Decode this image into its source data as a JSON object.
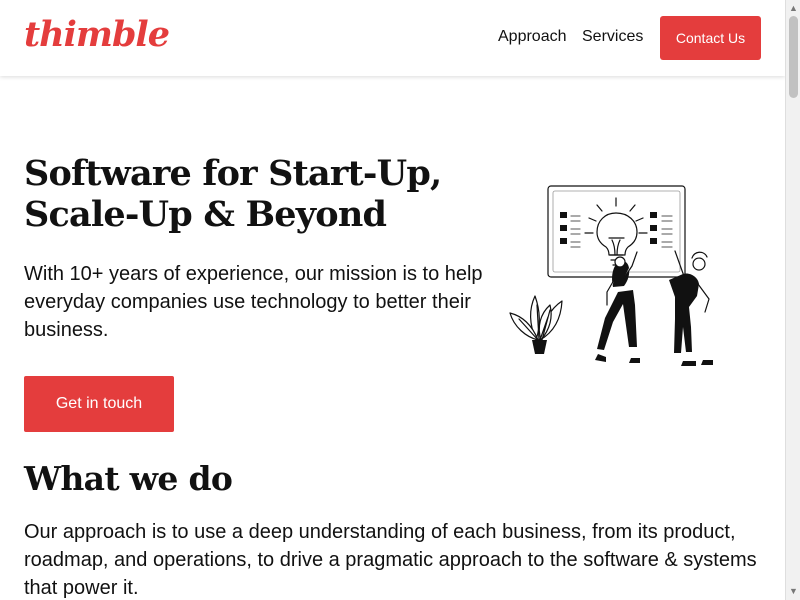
{
  "brand": {
    "name": "thimble",
    "accent_color": "#e43d3d"
  },
  "navigation": {
    "links": [
      {
        "label": "Approach"
      },
      {
        "label": "Services"
      }
    ],
    "contact_button": "Contact Us"
  },
  "hero": {
    "title_lines": [
      "Software for Start-Up,",
      "Scale-Up & Beyond"
    ],
    "description": "With 10+ years of experience, our mission is to help everyday companies use technology to better their business.",
    "button_label": "Get in touch",
    "illustration_icon": "lightbulb-presentation-icon"
  },
  "services": {
    "heading": "What we do",
    "description": "Our approach is to use a deep understanding of each business, from its product, roadmap, and operations, to drive a pragmatic approach to the software & systems that power it."
  },
  "scrollbar": {
    "up_icon": "scroll-up-arrow-icon",
    "down_icon": "scroll-down-arrow-icon"
  }
}
